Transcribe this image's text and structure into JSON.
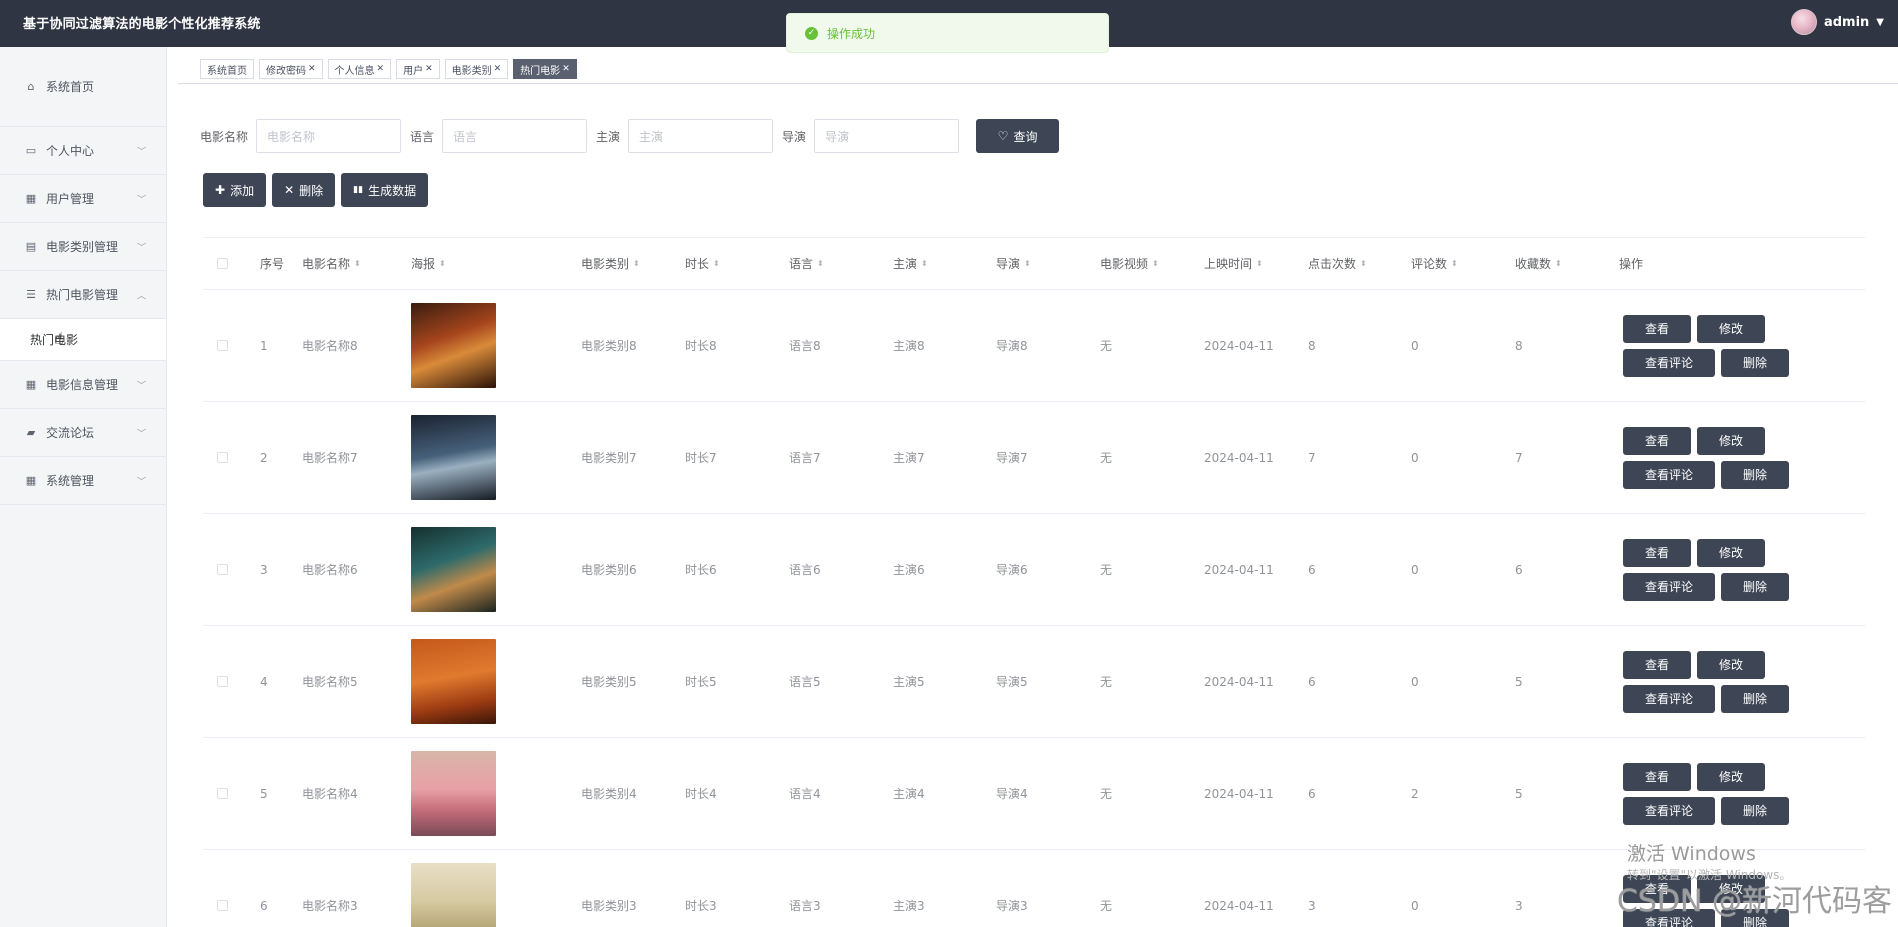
{
  "app": {
    "title": "基于协同过滤算法的电影个性化推荐系统"
  },
  "user": {
    "name": "admin"
  },
  "toast": {
    "message": "操作成功"
  },
  "sidebar": {
    "items": [
      {
        "label": "系统首页",
        "icon": "home-icon"
      },
      {
        "label": "个人中心",
        "icon": "user-card-icon"
      },
      {
        "label": "用户管理",
        "icon": "grid-icon"
      },
      {
        "label": "电影类别管理",
        "icon": "clipboard-icon"
      },
      {
        "label": "热门电影管理",
        "icon": "sliders-icon"
      },
      {
        "label": "电影信息管理",
        "icon": "apps-icon"
      },
      {
        "label": "交流论坛",
        "icon": "wallet-icon"
      },
      {
        "label": "系统管理",
        "icon": "grid-icon"
      }
    ],
    "submenu": {
      "label": "热门电影"
    }
  },
  "tabs": [
    {
      "label": "系统首页"
    },
    {
      "label": "修改密码"
    },
    {
      "label": "个人信息"
    },
    {
      "label": "用户"
    },
    {
      "label": "电影类别"
    },
    {
      "label": "热门电影"
    }
  ],
  "search": {
    "fields": [
      {
        "label": "电影名称",
        "placeholder": "电影名称"
      },
      {
        "label": "语言",
        "placeholder": "语言"
      },
      {
        "label": "主演",
        "placeholder": "主演"
      },
      {
        "label": "导演",
        "placeholder": "导演"
      }
    ],
    "query_label": "查询"
  },
  "actions": {
    "add_label": "添加",
    "delete_label": "删除",
    "generate_label": "生成数据"
  },
  "table": {
    "columns": [
      "序号",
      "电影名称",
      "海报",
      "电影类别",
      "时长",
      "语言",
      "主演",
      "导演",
      "电影视频",
      "上映时间",
      "点击次数",
      "评论数",
      "收藏数",
      "操作"
    ],
    "rows": [
      {
        "no": "1",
        "name": "电影名称8",
        "category": "电影类别8",
        "duration": "时长8",
        "language": "语言8",
        "actor": "主演8",
        "director": "导演8",
        "video": "无",
        "date": "2024-04-11",
        "clicks": "8",
        "comments": "0",
        "favorites": "8"
      },
      {
        "no": "2",
        "name": "电影名称7",
        "category": "电影类别7",
        "duration": "时长7",
        "language": "语言7",
        "actor": "主演7",
        "director": "导演7",
        "video": "无",
        "date": "2024-04-11",
        "clicks": "7",
        "comments": "0",
        "favorites": "7"
      },
      {
        "no": "3",
        "name": "电影名称6",
        "category": "电影类别6",
        "duration": "时长6",
        "language": "语言6",
        "actor": "主演6",
        "director": "导演6",
        "video": "无",
        "date": "2024-04-11",
        "clicks": "6",
        "comments": "0",
        "favorites": "6"
      },
      {
        "no": "4",
        "name": "电影名称5",
        "category": "电影类别5",
        "duration": "时长5",
        "language": "语言5",
        "actor": "主演5",
        "director": "导演5",
        "video": "无",
        "date": "2024-04-11",
        "clicks": "6",
        "comments": "0",
        "favorites": "5"
      },
      {
        "no": "5",
        "name": "电影名称4",
        "category": "电影类别4",
        "duration": "时长4",
        "language": "语言4",
        "actor": "主演4",
        "director": "导演4",
        "video": "无",
        "date": "2024-04-11",
        "clicks": "6",
        "comments": "2",
        "favorites": "5"
      },
      {
        "no": "6",
        "name": "电影名称3",
        "category": "电影类别3",
        "duration": "时长3",
        "language": "语言3",
        "actor": "主演3",
        "director": "导演3",
        "video": "无",
        "date": "2024-04-11",
        "clicks": "3",
        "comments": "0",
        "favorites": "3"
      }
    ],
    "ops": {
      "view": "查看",
      "edit": "修改",
      "comments": "查看评论",
      "delete": "删除"
    }
  },
  "watermarks": {
    "windows": "激活 Windows",
    "windows_sub": "转到\"设置\"以激活 Windows。",
    "csdn": "CSDN @新河代码客"
  },
  "colors": {
    "topbar": "#2f3542",
    "button_dark": "#3e4655",
    "toast_green": "#67c23a"
  }
}
